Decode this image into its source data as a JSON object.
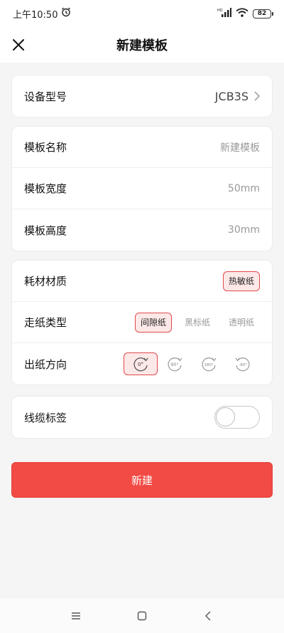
{
  "status_bar": {
    "time": "上午10:50",
    "battery": "82"
  },
  "header": {
    "title": "新建模板"
  },
  "device": {
    "label": "设备型号",
    "value": "JCB3S"
  },
  "template": {
    "name": {
      "label": "模板名称",
      "placeholder": "新建模板"
    },
    "width": {
      "label": "模板宽度",
      "placeholder": "50mm"
    },
    "height": {
      "label": "模板高度",
      "placeholder": "30mm"
    }
  },
  "material": {
    "label": "耗材材质",
    "options": [
      "热敏纸"
    ],
    "selected": "热敏纸"
  },
  "paper_type": {
    "label": "走纸类型",
    "options": [
      "间隙纸",
      "黑标纸",
      "透明纸"
    ],
    "selected": "间隙纸"
  },
  "direction": {
    "label": "出纸方向",
    "options": [
      "0°",
      "90°",
      "180°",
      "-90°"
    ],
    "selected": "0°"
  },
  "cable_label": {
    "label": "线缆标签",
    "enabled": false
  },
  "create_button": {
    "label": "新建"
  },
  "colors": {
    "accent": "#f24a44",
    "selected_bg": "#fde8e8"
  }
}
